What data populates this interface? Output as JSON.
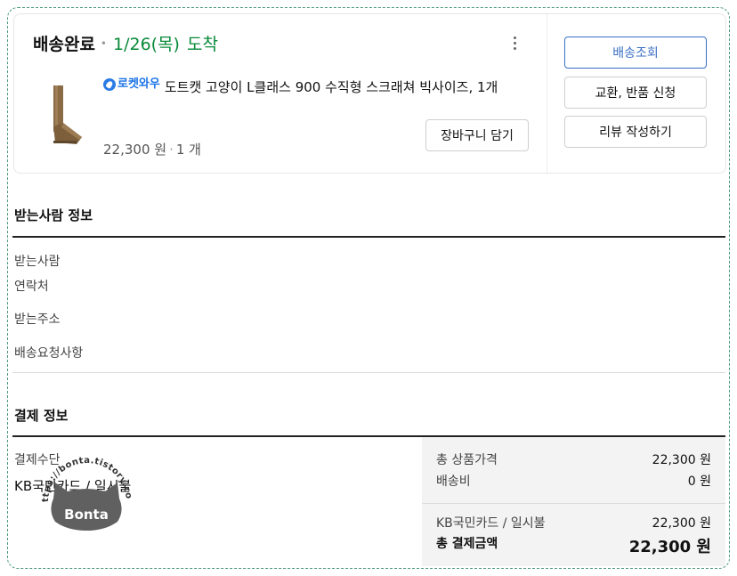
{
  "order": {
    "status": "배송완료",
    "date": "1/26(목)",
    "arrival": "도착",
    "product": {
      "badge": "로켓와우",
      "title": "도트캣 고양이 L클래스 900 수직형 스크래쳐 빅사이즈, 1개",
      "price": "22,300 원",
      "quantity": "1 개"
    },
    "cart_button": "장바구니 담기",
    "actions": [
      "배송조회",
      "교환, 반품 신청",
      "리뷰 작성하기"
    ]
  },
  "recipient": {
    "title": "받는사람 정보",
    "labels": [
      "받는사람",
      "연락처",
      "받는주소",
      "배송요청사항"
    ]
  },
  "payment": {
    "title": "결제 정보",
    "method_label": "결제수단",
    "method_value": "KB국민카드 / 일시불",
    "rows": [
      {
        "label": "총 상품가격",
        "value": "22,300 원"
      },
      {
        "label": "배송비",
        "value": "0 원"
      },
      {
        "label": "KB국민카드 / 일시불",
        "value": "22,300 원"
      },
      {
        "label": "총 결제금액",
        "value": "22,300 원"
      }
    ]
  },
  "watermark": {
    "url": "https://bonta.tistory.com",
    "name": "Bonta"
  },
  "colors": {
    "delivered_green": "#0a8a3a",
    "primary_blue": "#3a6fc4",
    "rocket_blue": "#1a73e8"
  },
  "icons": {
    "rocket": "rocket-icon",
    "more": "kebab-menu-icon"
  }
}
